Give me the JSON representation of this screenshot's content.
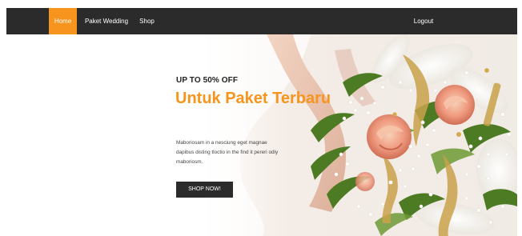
{
  "nav": {
    "home": "Home",
    "paket_wedding": "Paket Wedding",
    "shop": "Shop",
    "logout": "Logout",
    "active_color": "#f7941d",
    "bar_color": "#2b2b2b"
  },
  "hero": {
    "promo": "UP TO 50% OFF",
    "title": "Untuk Paket Terbaru",
    "description": "Maboriosam in a nesciung eget magnae dapibus disting tloctio in the find it pereri odiy maboriosm.",
    "button_label": "SHOP NOW!",
    "image_icon": "wedding-bouquet-image"
  }
}
